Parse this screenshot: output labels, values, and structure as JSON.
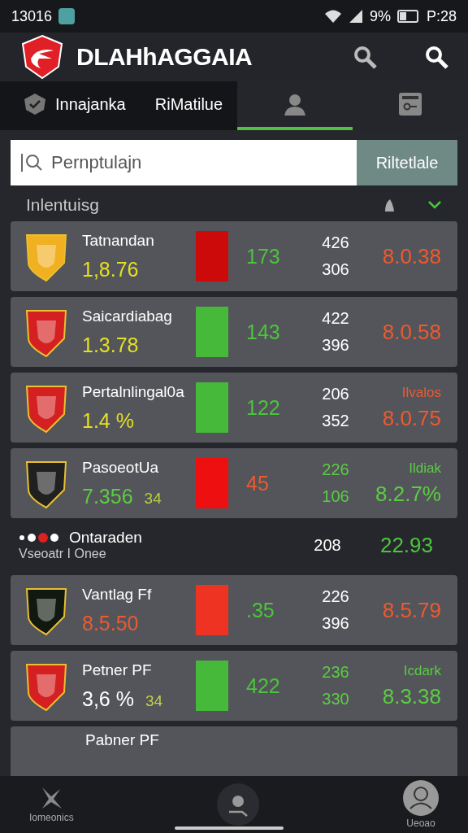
{
  "status_bar": {
    "time": "13016",
    "battery_text": "9%",
    "clock": "P:28"
  },
  "header": {
    "title": "DLAHhAGGAIA"
  },
  "tabs": [
    {
      "label": "Innajanka",
      "kind": "check",
      "selected": false
    },
    {
      "label": "RiMatilue",
      "kind": "text",
      "selected": false
    },
    {
      "kind": "person",
      "selected": true
    },
    {
      "kind": "card",
      "selected": false
    }
  ],
  "search": {
    "placeholder": "Pernptulajn",
    "button": "Riltetlale"
  },
  "section": {
    "title": "Inlentuisg",
    "expanded": true
  },
  "rows": [
    {
      "kind": "card",
      "crest": {
        "color": "#f0b020"
      },
      "name": "Tatnandan",
      "value": {
        "text": "1,8.76",
        "color": "#e4e021"
      },
      "bar": {
        "color": "#cc0a0a"
      },
      "number": {
        "text": "173",
        "color": "#4cc43c"
      },
      "stats": [
        {
          "text": "426",
          "color": "#ffffff"
        },
        {
          "text": "306",
          "color": "#ffffff"
        }
      ],
      "result": {
        "text": "8.0.38",
        "color": "#ee5a30"
      }
    },
    {
      "kind": "card",
      "crest": {
        "color": "#d42020"
      },
      "name": "Saicardiabag",
      "value": {
        "text": "1.3.78",
        "color": "#e4e021"
      },
      "bar": {
        "color": "#46b83a"
      },
      "number": {
        "text": "143",
        "color": "#4cc43c"
      },
      "stats": [
        {
          "text": "422",
          "color": "#ffffff"
        },
        {
          "text": "396",
          "color": "#ffffff"
        }
      ],
      "result": {
        "text": "8.0.58",
        "color": "#ee5a30"
      }
    },
    {
      "kind": "card",
      "crest": {
        "color": "#d42020"
      },
      "name": "Pertalnlingal0a",
      "value": {
        "text": "1.4 %",
        "color": "#e4e021"
      },
      "bar": {
        "color": "#46b83a"
      },
      "number": {
        "text": "122",
        "color": "#4cc43c"
      },
      "stats": [
        {
          "text": "206",
          "color": "#ffffff"
        },
        {
          "text": "352",
          "color": "#ffffff"
        }
      ],
      "label": {
        "text": "Ilvalos",
        "color": "#ee5a30"
      },
      "result": {
        "text": "8.0.75",
        "color": "#ee5a30"
      }
    },
    {
      "kind": "card",
      "crest": {
        "color": "#202020"
      },
      "name": "PasoeotUa",
      "value": {
        "text": "7.356",
        "color": "#5ccc44"
      },
      "extra": {
        "text": "34",
        "color": "#b8d040"
      },
      "bar": {
        "color": "#ee1010"
      },
      "number": {
        "text": "45",
        "color": "#ee5a30"
      },
      "stats": [
        {
          "text": "226",
          "color": "#5ccc44"
        },
        {
          "text": "106",
          "color": "#5ccc44"
        }
      ],
      "label": {
        "text": "Ildiak",
        "color": "#5ccc44"
      },
      "result": {
        "text": "8.2.7%",
        "color": "#5ccc44"
      }
    },
    {
      "kind": "plain",
      "name": "Ontaraden",
      "subtitle": "Vseoatr I Onee",
      "stats": [
        {
          "text": "208",
          "color": "#ffffff"
        }
      ],
      "result": {
        "text": "22.93",
        "color": "#4cc43c"
      }
    },
    {
      "kind": "card",
      "crest": {
        "color": "#101810"
      },
      "name": "Vantlag Ff",
      "value": {
        "text": "8.5.50",
        "color": "#ee5a30"
      },
      "bar": {
        "color": "#ee3322"
      },
      "number": {
        "text": ".35",
        "color": "#4cc43c"
      },
      "stats": [
        {
          "text": "226",
          "color": "#ffffff"
        },
        {
          "text": "396",
          "color": "#ffffff"
        }
      ],
      "result": {
        "text": "8.5.79",
        "color": "#ee5a30"
      }
    },
    {
      "kind": "card",
      "crest": {
        "color": "#d42020"
      },
      "name": "Petner PF",
      "value": {
        "text": "3,6 %",
        "color": "#ffffff"
      },
      "extra": {
        "text": "34",
        "color": "#c8d040"
      },
      "bar": {
        "color": "#46b83a"
      },
      "number": {
        "text": "422",
        "color": "#4cc43c"
      },
      "stats": [
        {
          "text": "236",
          "color": "#5ccc44"
        },
        {
          "text": "330",
          "color": "#5ccc44"
        }
      ],
      "label": {
        "text": "Icdark",
        "color": "#5ccc44"
      },
      "result": {
        "text": "8.3.38",
        "color": "#5ccc44"
      }
    },
    {
      "kind": "partial",
      "name": "Pabner PF"
    }
  ],
  "bottom_nav": [
    {
      "kind": "home",
      "label": "Iomeonics"
    },
    {
      "kind": "search"
    },
    {
      "kind": "profile",
      "label": "Ueoao"
    }
  ]
}
